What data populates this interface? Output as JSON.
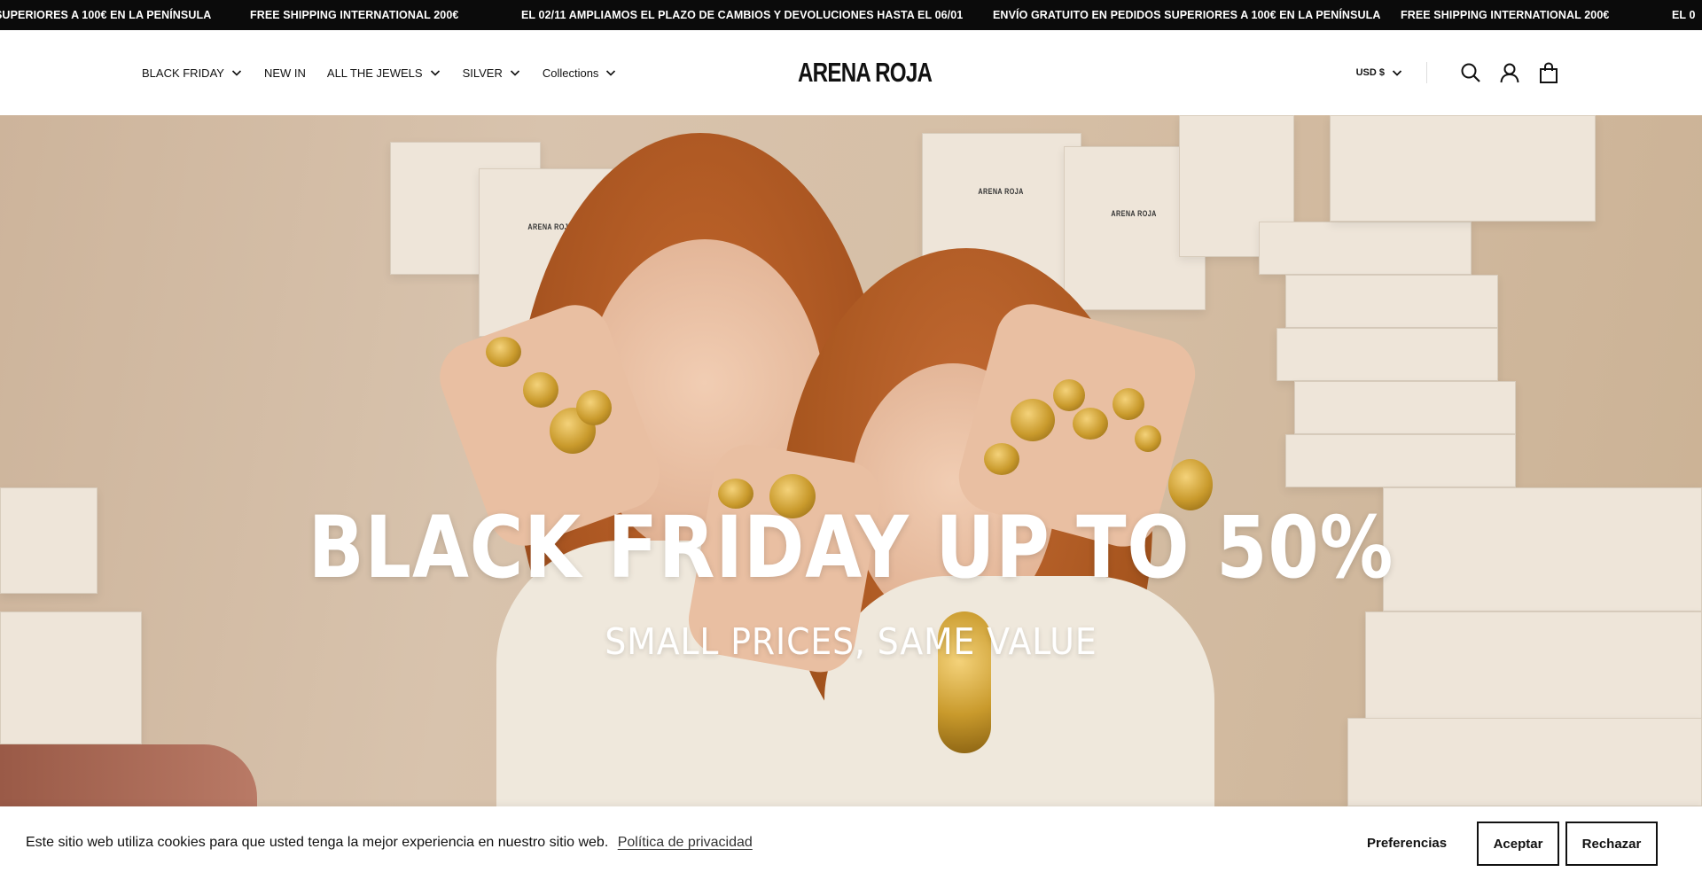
{
  "announcement": {
    "items": [
      "SUPERIORES A 100€ EN LA PENÍNSULA",
      "FREE SHIPPING INTERNATIONAL 200€",
      "EL 02/11 AMPLIAMOS EL PLAZO DE CAMBIOS Y DEVOLUCIONES HASTA EL 06/01",
      "ENVÍO GRATUITO EN PEDIDOS SUPERIORES A 100€ EN LA PENÍNSULA",
      "FREE SHIPPING INTERNATIONAL 200€",
      "EL 0"
    ]
  },
  "header": {
    "nav": [
      {
        "label": "BLACK FRIDAY",
        "dropdown": true
      },
      {
        "label": "NEW IN",
        "dropdown": false
      },
      {
        "label": "ALL THE JEWELS",
        "dropdown": true
      },
      {
        "label": "SILVER",
        "dropdown": true
      },
      {
        "label": "Collections",
        "dropdown": true
      }
    ],
    "logo": "ARENA ROJA",
    "currency": "USD $",
    "icons": [
      "search-icon",
      "account-icon",
      "cart-icon"
    ]
  },
  "hero": {
    "title": "BLACK FRIDAY UP TO 50%",
    "subtitle": "SMALL PRICES, SAME VALUE",
    "box_label": "ARENA ROJA"
  },
  "cookie": {
    "text": "Este sitio web utiliza cookies para que usted tenga la mejor experiencia en nuestro sitio web.",
    "link": "Política de privacidad",
    "preferences": "Preferencias",
    "accept": "Aceptar",
    "reject": "Rechazar",
    "close": ""
  },
  "colors": {
    "announcement_bg": "#0b0b0b",
    "text": "#111111",
    "hero_tint": "#d6bfa6",
    "gold": "#c99a2c"
  }
}
